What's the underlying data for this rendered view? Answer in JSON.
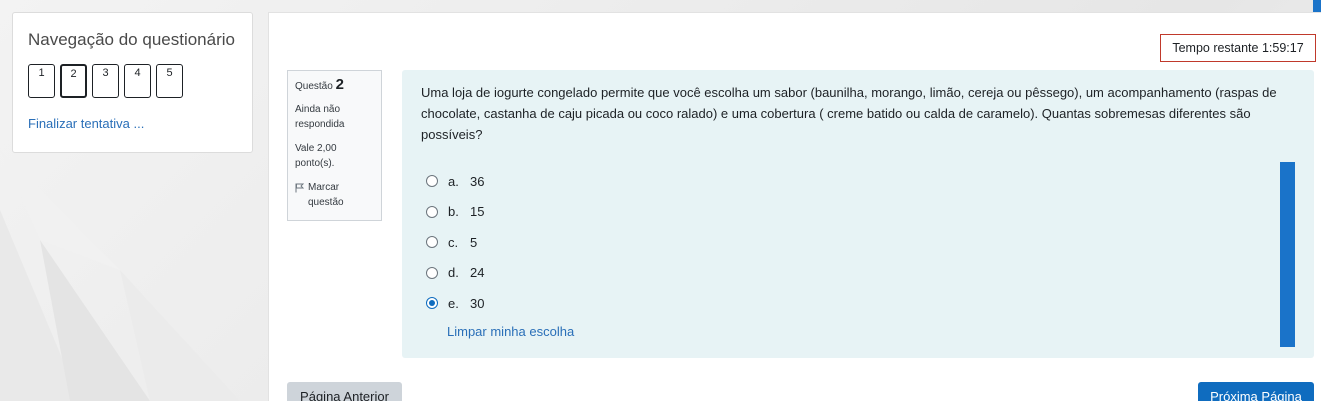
{
  "navigation": {
    "title": "Navegação do questionário",
    "questions": [
      {
        "label": "1",
        "current": false
      },
      {
        "label": "2",
        "current": true
      },
      {
        "label": "3",
        "current": false
      },
      {
        "label": "4",
        "current": false
      },
      {
        "label": "5",
        "current": false
      }
    ],
    "finish_label": "Finalizar tentativa ..."
  },
  "timer": {
    "text": "Tempo restante 1:59:17"
  },
  "question_info": {
    "prefix": "Questão",
    "number": "2",
    "state": "Ainda não respondida",
    "grade": "Vale 2,00 ponto(s).",
    "flag_label": "Marcar questão",
    "flag_icon": "flag-icon"
  },
  "question": {
    "text": "Uma loja de iogurte congelado permite que você escolha um sabor (baunilha, morango, limão, cereja ou pêssego), um acompanhamento (raspas de chocolate, castanha de caju picada ou coco ralado) e uma cobertura ( creme batido ou calda de caramelo). Quantas sobremesas diferentes são possíveis?",
    "answers": [
      {
        "letter": "a.",
        "value": "36",
        "checked": false
      },
      {
        "letter": "b.",
        "value": "15",
        "checked": false
      },
      {
        "letter": "c.",
        "value": "5",
        "checked": false
      },
      {
        "letter": "d.",
        "value": "24",
        "checked": false
      },
      {
        "letter": "e.",
        "value": "30",
        "checked": true
      }
    ],
    "clear_label": "Limpar minha escolha"
  },
  "buttons": {
    "prev_label": "Página Anterior",
    "next_label": "Próxima Página"
  },
  "colors": {
    "accent": "#0f6cbf",
    "link": "#2a6fb8",
    "timer_border": "#c0392b",
    "formulation_bg": "#e7f3f5"
  }
}
